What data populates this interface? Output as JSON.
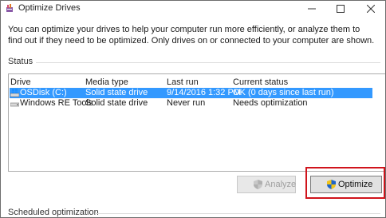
{
  "window": {
    "title": "Optimize Drives"
  },
  "description": "You can optimize your drives to help your computer run more efficiently, or analyze them to find out if they need to be optimized. Only drives on or connected to your computer are shown.",
  "status": {
    "header": "Status",
    "columns": [
      "Drive",
      "Media type",
      "Last run",
      "Current status"
    ],
    "rows": [
      {
        "drive": "OSDisk (C:)",
        "media_type": "Solid state drive",
        "last_run": "9/14/2016 1:32 PM",
        "current_status": "OK (0 days since last run)",
        "selected": true,
        "icon": "windows-drive-icon"
      },
      {
        "drive": "Windows RE Tools",
        "media_type": "Solid state drive",
        "last_run": "Never run",
        "current_status": "Needs optimization",
        "selected": false,
        "icon": "drive-icon"
      }
    ]
  },
  "buttons": {
    "analyze": "Analyze",
    "optimize": "Optimize",
    "analyze_enabled": false
  },
  "scheduled": {
    "header": "Scheduled optimization"
  },
  "colors": {
    "selection": "#3399ff",
    "highlight": "#d0141c"
  }
}
